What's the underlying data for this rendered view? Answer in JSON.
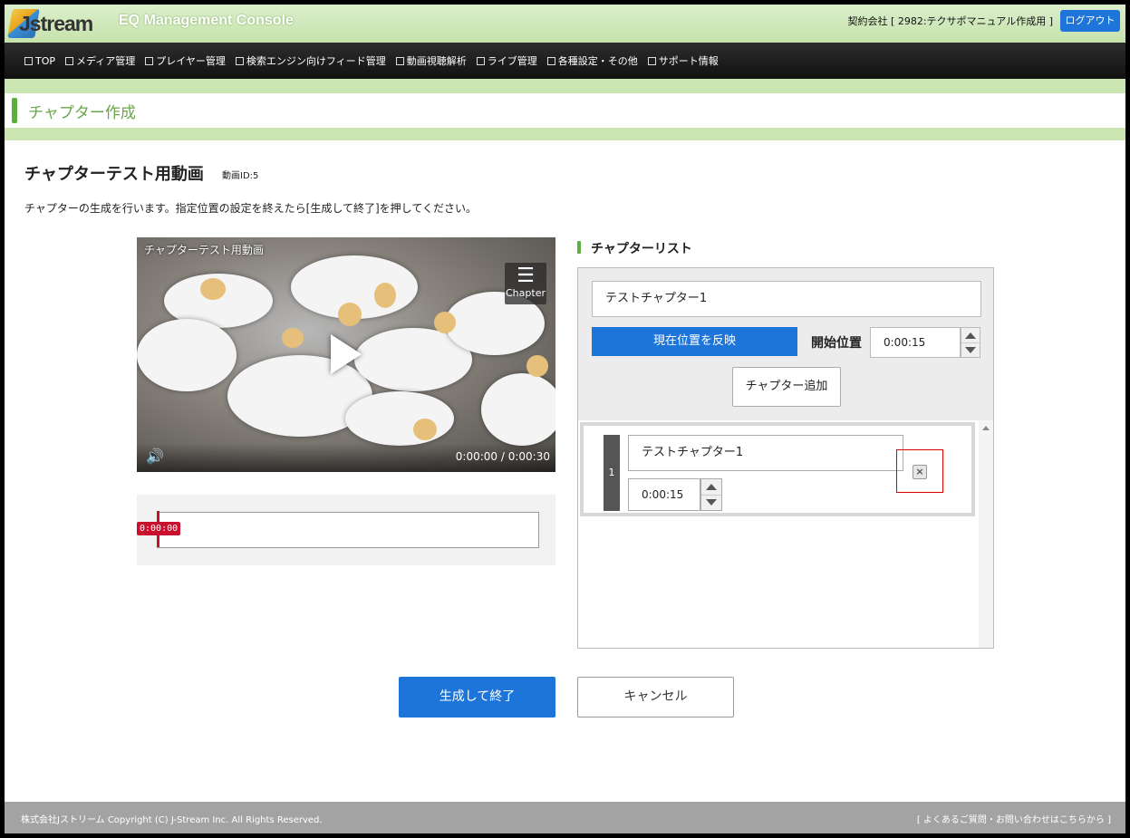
{
  "header": {
    "logo_text": "Jstream",
    "console_title": "EQ Management Console",
    "company": "契約会社 [ 2982:テクサポマニュアル作成用 ]",
    "logout_label": "ログアウト"
  },
  "nav": {
    "items": [
      {
        "label": "TOP"
      },
      {
        "label": "メディア管理"
      },
      {
        "label": "プレイヤー管理"
      },
      {
        "label": "検索エンジン向けフィード管理"
      },
      {
        "label": "動画視聴解析"
      },
      {
        "label": "ライブ管理"
      },
      {
        "label": "各種設定・その他"
      },
      {
        "label": "サポート情報"
      }
    ]
  },
  "subheader": {
    "title": "チャプター作成"
  },
  "page": {
    "title": "チャプターテスト用動画",
    "video_id": "動画ID:5",
    "description": "チャプターの生成を行います。指定位置の設定を終えたら[生成して終了]を押してください。"
  },
  "video": {
    "title": "チャプターテスト用動画",
    "chapter_icon_label": "Chapter",
    "time": "0:00:00 / 0:00:30",
    "play_icon": "play-icon",
    "volume_icon": "volume-icon"
  },
  "timeline": {
    "marker_label": "0:00:00"
  },
  "chapter_list": {
    "title": "チャプターリスト",
    "name_input_value": "テストチャプター1",
    "reflect_button": "現在位置を反映",
    "start_label": "開始位置",
    "start_value": "0:00:15",
    "add_button": "チャプター追加",
    "rows": [
      {
        "number": "1",
        "name": "テストチャプター1",
        "time": "0:00:15",
        "delete_icon": "×"
      }
    ]
  },
  "actions": {
    "finish_button": "生成して終了",
    "cancel_button": "キャンセル"
  },
  "footer": {
    "copyright": "株式会社Jストリーム Copyright (C) J-Stream Inc. All Rights Reserved.",
    "support_link": "[ よくあるご質問・お問い合わせはこちらから ]"
  },
  "colors": {
    "accent_blue": "#1e75d9",
    "accent_green": "#5ab23d",
    "marker_red": "#c8102e"
  }
}
